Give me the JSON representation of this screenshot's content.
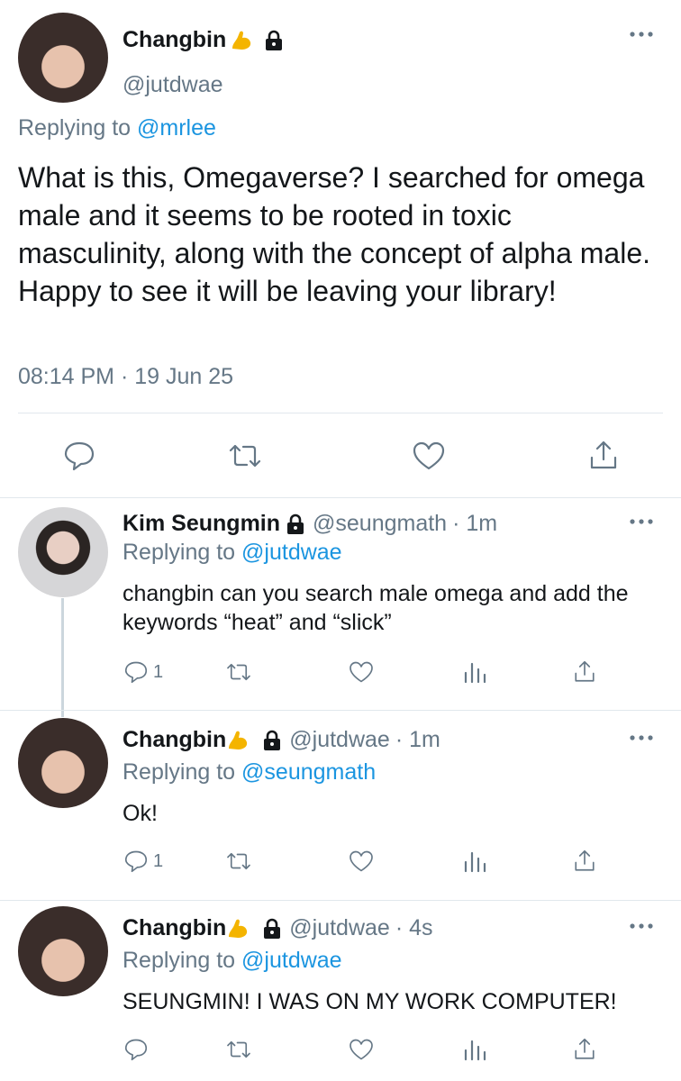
{
  "main_tweet": {
    "name": "Changbin",
    "handle": "@jutdwae",
    "replying_prefix": "Replying to",
    "replying_to": "@mrlee",
    "text": "What is this, Omegaverse? I searched for omega male and it seems to be rooted in toxic masculinity, along with the concept of alpha male. Happy to see it will be leaving your library!",
    "time": "08:14 PM · 19 Jun 25",
    "icons": [
      "flexed-biceps-emoji",
      "lock-icon",
      "more-icon",
      "reply-icon",
      "retweet-icon",
      "like-icon",
      "share-icon"
    ]
  },
  "replies": [
    {
      "name": "Kim Seungmin",
      "handle": "@seungmath",
      "time": "· 1m",
      "replying_prefix": "Replying to",
      "replying_to": "@jutdwae",
      "text": "changbin can you search male omega and add the keywords “heat” and “slick”",
      "reply_count": "1"
    },
    {
      "name": "Changbin",
      "handle": "@jutdwae",
      "time": "· 1m",
      "replying_prefix": "Replying to",
      "replying_to": "@seungmath",
      "text": "Ok!",
      "reply_count": "1"
    },
    {
      "name": "Changbin",
      "handle": "@jutdwae",
      "time": "· 4s",
      "replying_prefix": "Replying to",
      "replying_to": "@jutdwae",
      "text": "SEUNGMIN! I WAS ON MY WORK COMPUTER!",
      "reply_count": ""
    }
  ],
  "colors": {
    "text": "#14171a",
    "muted": "#657786",
    "link": "#1b95e0",
    "divider": "#e1e8ed",
    "thread_line": "#ccd6dd",
    "emoji": "#f4b400"
  }
}
